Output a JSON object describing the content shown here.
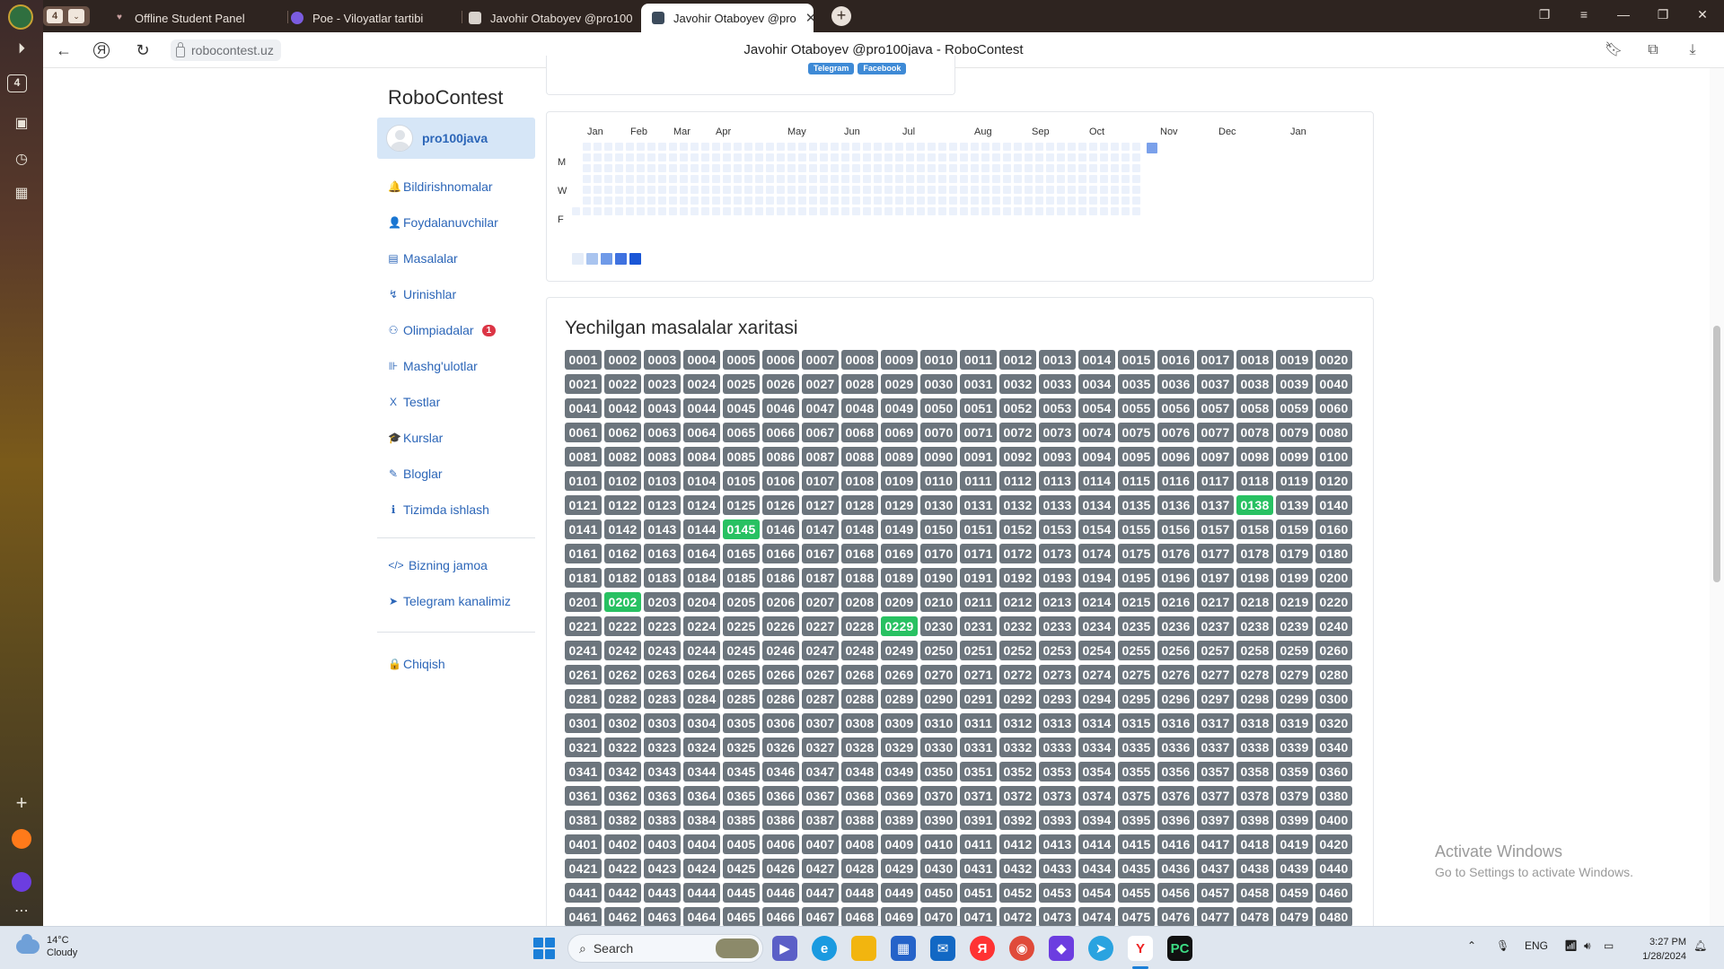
{
  "browser": {
    "tab_counter": "4",
    "tabs": [
      {
        "title": "Offline Student Panel",
        "active": false
      },
      {
        "title": "Poe - Viloyatlar tartibi",
        "active": false
      },
      {
        "title": "Javohir Otaboyev @pro100",
        "active": false
      },
      {
        "title": "Javohir Otaboyev @pro",
        "active": true
      }
    ],
    "url": "robocontest.uz",
    "page_title": "Javohir Otaboyev @pro100java - RoboContest"
  },
  "sidebar": {
    "brand": "RoboContest",
    "username": "pro100java",
    "menu": [
      {
        "label": "Bildirishnomalar",
        "icon": "bell-icon",
        "glyph": "🔔"
      },
      {
        "label": "Foydalanuvchilar",
        "icon": "user-icon",
        "glyph": "👤"
      },
      {
        "label": "Masalalar",
        "icon": "book-icon",
        "glyph": "▤"
      },
      {
        "label": "Urinishlar",
        "icon": "attempt-icon",
        "glyph": "↯"
      },
      {
        "label": "Olimpiadalar",
        "icon": "medal-icon",
        "glyph": "⚇",
        "badge": "1"
      },
      {
        "label": "Mashg'ulotlar",
        "icon": "dumbbell-icon",
        "glyph": "⊪"
      },
      {
        "label": "Testlar",
        "icon": "subscript-icon",
        "glyph": "X"
      },
      {
        "label": "Kurslar",
        "icon": "graduation-cap-icon",
        "glyph": "🎓"
      },
      {
        "label": "Bloglar",
        "icon": "pen-icon",
        "glyph": "✎"
      },
      {
        "label": "Tizimda ishlash",
        "icon": "info-icon",
        "glyph": "ℹ"
      }
    ],
    "secondary": [
      {
        "label": "Bizning jamoa",
        "icon": "code-icon",
        "glyph": "</>"
      },
      {
        "label": "Telegram kanalimiz",
        "icon": "telegram-icon",
        "glyph": "➤"
      }
    ],
    "logout": {
      "label": "Chiqish",
      "icon": "lock-icon",
      "glyph": "🔒"
    }
  },
  "profile_card": {
    "share_buttons": [
      "Telegram",
      "Facebook"
    ]
  },
  "activity": {
    "months": [
      "Jan",
      "Feb",
      "Mar",
      "Apr",
      "May",
      "Jun",
      "Jul",
      "Aug",
      "Sep",
      "Oct",
      "Nov",
      "Dec",
      "Jan"
    ],
    "day_labels": [
      "M",
      "W",
      "F"
    ],
    "colors": {
      "empty": "#ebf1fb",
      "levels": [
        "#e4ecf8",
        "#a9c4ef",
        "#6f9ae8",
        "#3f72e0",
        "#1a56d6"
      ],
      "highlight": "#7aa0ea"
    }
  },
  "problems": {
    "title": "Yechilgan masalalar xaritasi",
    "first": 1,
    "last": 480,
    "solved": [
      "0138",
      "0145",
      "0202",
      "0229"
    ],
    "colors": {
      "unsolved": "#6c757d",
      "solved": "#28c162"
    }
  },
  "watermark": {
    "line1": "Activate Windows",
    "line2": "Go to Settings to activate Windows."
  },
  "taskbar": {
    "temperature": "14°C",
    "condition": "Cloudy",
    "search_placeholder": "Search",
    "language": "ENG",
    "time": "3:27 PM",
    "date": "1/28/2024"
  }
}
